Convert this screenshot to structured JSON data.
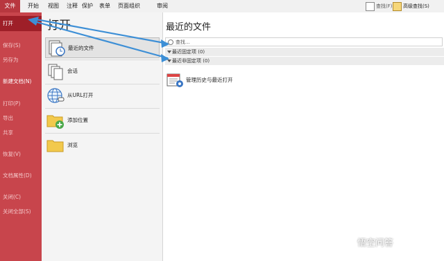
{
  "ribbon": {
    "tabs": [
      "文件",
      "开始",
      "视图",
      "注释",
      "保护",
      "表单",
      "页面组织",
      "审阅"
    ],
    "find": "查找(F)",
    "advanced_find": "高级查找(S)"
  },
  "sidebar": {
    "items": [
      {
        "label": "打开",
        "state": "selected"
      },
      {
        "label": "保存(S)",
        "state": "dim"
      },
      {
        "label": "另存为",
        "state": "dim"
      },
      {
        "label": "新建文档(N)",
        "state": "bright"
      },
      {
        "label": "打印(P)",
        "state": "dim"
      },
      {
        "label": "导出",
        "state": "dim"
      },
      {
        "label": "共享",
        "state": "dim"
      },
      {
        "label": "恢复(V)",
        "state": "dim"
      },
      {
        "label": "文档属性(D)",
        "state": "dim"
      },
      {
        "label": "关闭(C)",
        "state": "dim"
      },
      {
        "label": "关闭全部(S)",
        "state": "dim"
      }
    ]
  },
  "open_panel": {
    "title": "打开",
    "options": [
      {
        "label": "最近的文件",
        "icon": "recent-files-icon",
        "selected": true
      },
      {
        "label": "会话",
        "icon": "session-icon",
        "selected": false
      },
      {
        "label": "从URL打开",
        "icon": "globe-icon",
        "selected": false
      },
      {
        "label": "添加位置",
        "icon": "add-location-icon",
        "selected": false
      },
      {
        "label": "浏览",
        "icon": "folder-icon",
        "selected": false
      }
    ]
  },
  "recent": {
    "title": "最近的文件",
    "search_placeholder": "查找...",
    "pinned": "最近固定项 (0)",
    "unpinned": "最近非固定项 (0)",
    "manage": "管理历史与最近打开"
  },
  "watermark": "悟空问答",
  "colors": {
    "accent": "#c8454c",
    "accent_dark": "#9e1f28",
    "arrow": "#3d8fd6"
  }
}
